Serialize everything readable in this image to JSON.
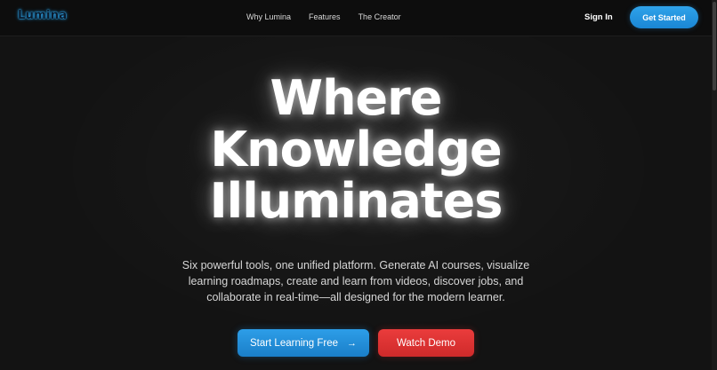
{
  "nav": {
    "logo": "Lumina",
    "links": [
      "Why Lumina",
      "Features",
      "The Creator"
    ],
    "sign_in": "Sign In",
    "get_started": "Get Started"
  },
  "hero": {
    "title_lines": [
      "Where",
      "Knowledge",
      "Illuminates"
    ],
    "description": "Six powerful tools, one unified platform. Generate AI courses, visualize learning roadmaps, create and learn from videos, discover jobs, and collaborate in real-time—all designed for the modern learner.",
    "primary_cta": "Start Learning Free",
    "primary_cta_icon": "arrow-right-icon",
    "secondary_cta": "Watch Demo"
  },
  "colors": {
    "background": "#131313",
    "accent_blue": "#2196e0",
    "accent_red": "#e03535",
    "logo_glow": "#35b6ff"
  }
}
